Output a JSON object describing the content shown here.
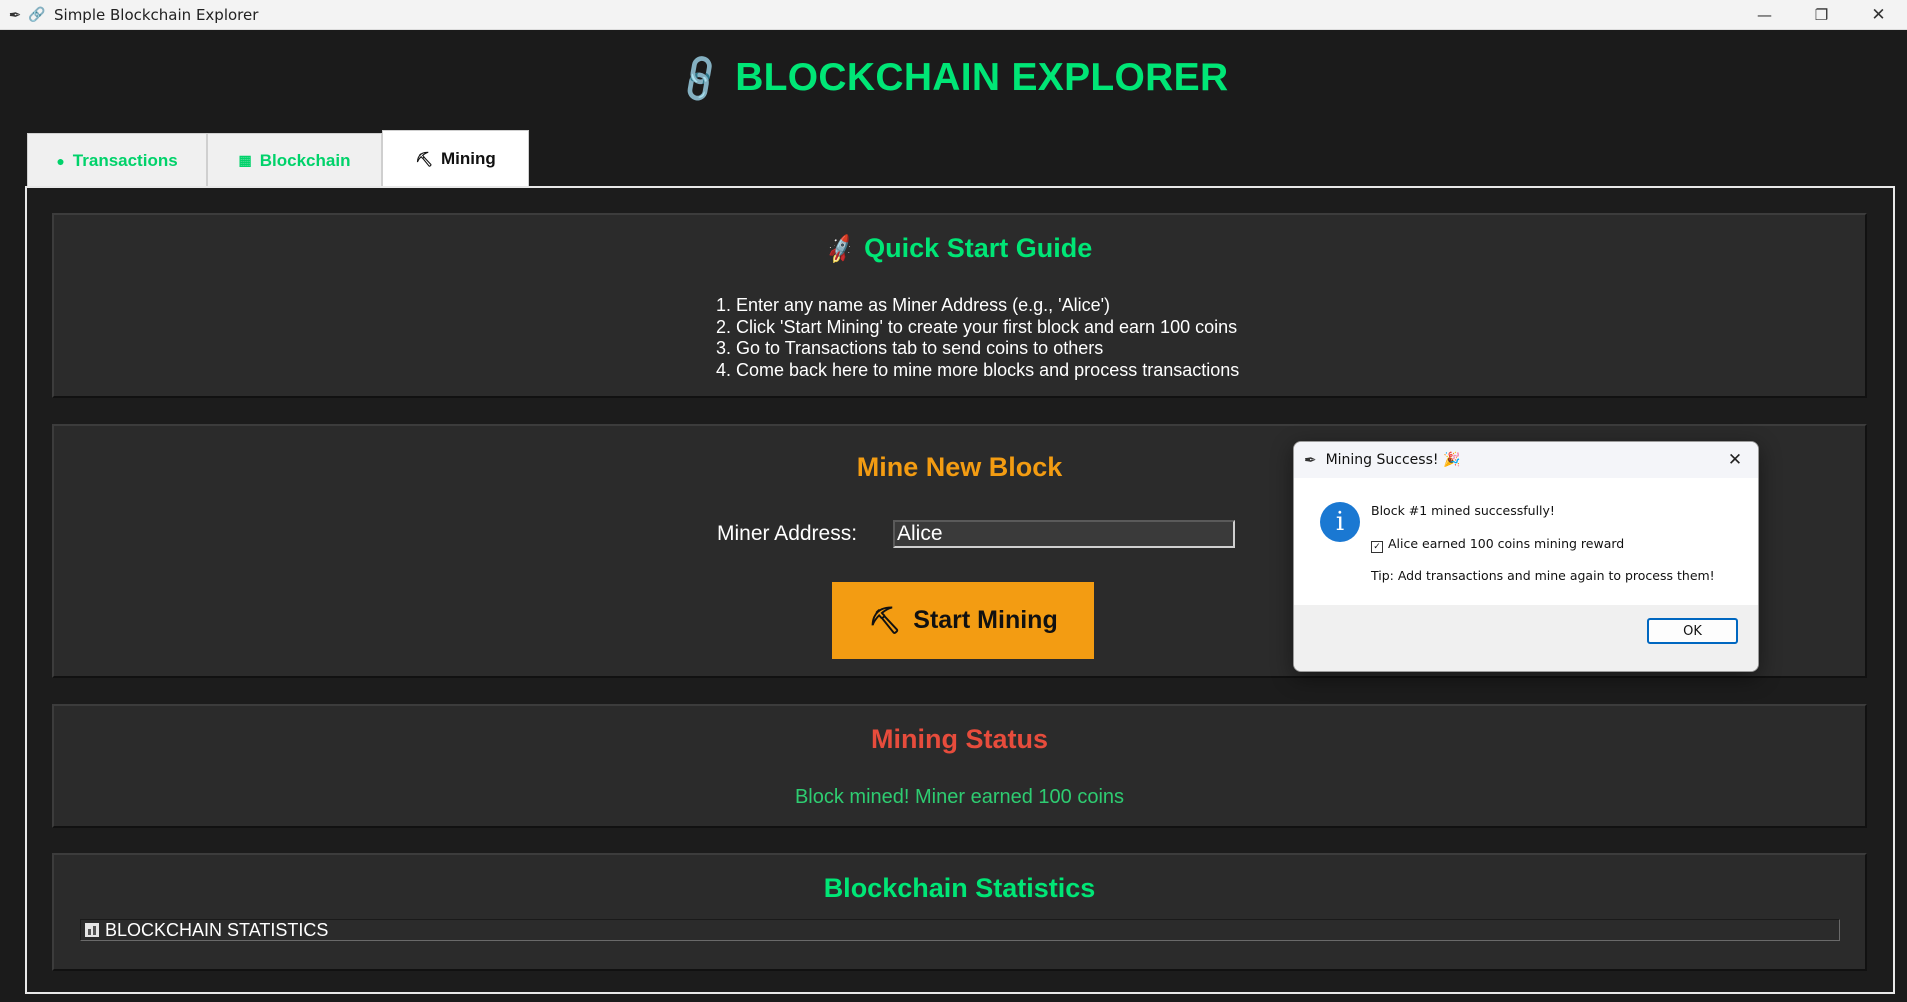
{
  "window": {
    "title": "Simple Blockchain Explorer",
    "app_icon": "feather-icon",
    "title_icon": "🔗",
    "minimize": "—",
    "maximize": "❐",
    "close": "✕"
  },
  "header": {
    "icon": "🔗",
    "title": "BLOCKCHAIN EXPLORER"
  },
  "tabs": [
    {
      "icon": "●",
      "label": "Transactions",
      "active": false
    },
    {
      "icon": "▦",
      "label": "Blockchain",
      "active": false
    },
    {
      "icon": "⛏",
      "label": "Mining",
      "active": true
    }
  ],
  "guide": {
    "icon": "🚀",
    "title": "Quick Start Guide",
    "steps": [
      "1. Enter any name as Miner Address (e.g., 'Alice')",
      "2. Click 'Start Mining' to create your first block and earn 100 coins",
      "3. Go to Transactions tab to send coins to others",
      "4. Come back here to mine more blocks and process transactions"
    ]
  },
  "mine": {
    "title": "Mine New Block",
    "miner_label": "Miner Address:",
    "miner_value": "Alice",
    "button_icon": "⛏",
    "button_label": "Start Mining"
  },
  "status": {
    "title": "Mining Status",
    "message": "Block mined! Miner earned 100 coins"
  },
  "stats": {
    "title": "Blockchain Statistics",
    "box_text": "BLOCKCHAIN STATISTICS"
  },
  "dialog": {
    "title": "Mining Success! 🎉",
    "close": "✕",
    "info_symbol": "i",
    "line1": "Block #1 mined successfully!",
    "check": "✓",
    "line2": "Alice earned 100 coins mining reward",
    "line3": "Tip: Add transactions and mine again to process them!",
    "ok_label": "OK"
  },
  "colors": {
    "accent_green": "#00e676",
    "accent_orange": "#f39c12",
    "status_red": "#e74c3c",
    "status_green": "#2ecc71",
    "background": "#1b1b1b",
    "panel": "#2b2b2b"
  }
}
